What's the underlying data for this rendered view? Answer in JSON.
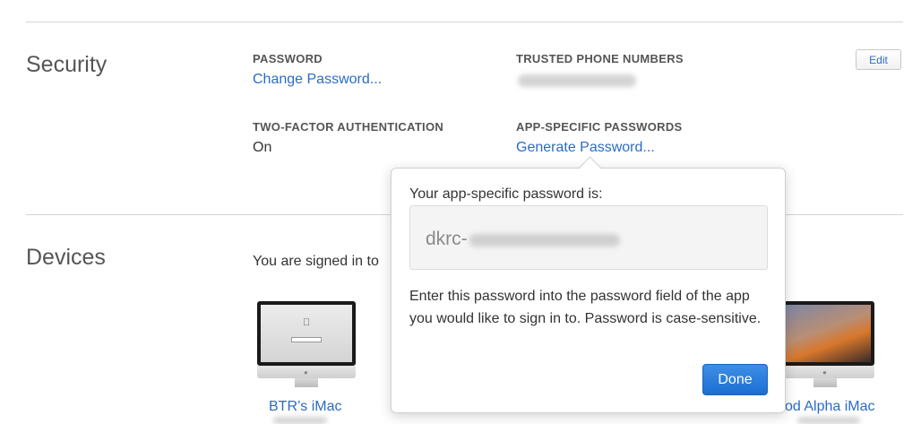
{
  "security": {
    "title": "Security",
    "password_label": "PASSWORD",
    "change_password": "Change Password...",
    "trusted_label": "TRUSTED PHONE NUMBERS",
    "two_factor_label": "TWO-FACTOR AUTHENTICATION",
    "two_factor_value": "On",
    "app_specific_label": "APP-SPECIFIC PASSWORDS",
    "generate_password": "Generate Password...",
    "edit_label": "Edit"
  },
  "devices": {
    "title": "Devices",
    "signed_in_text": "You are signed in to",
    "items": [
      {
        "name": "BTR’s iMac",
        "icon": "imac-icon"
      },
      {
        "name": "od Alpha iMac",
        "icon": "imac-icon"
      }
    ]
  },
  "popover": {
    "heading": "Your app-specific password is:",
    "password_prefix": "dkrc-",
    "body": "Enter this password into the password field of the app you would like to sign in to. Password is case-sensitive.",
    "done_label": "Done"
  },
  "colors": {
    "link": "#2b6cc4",
    "done_button": "#1b6fd1"
  }
}
